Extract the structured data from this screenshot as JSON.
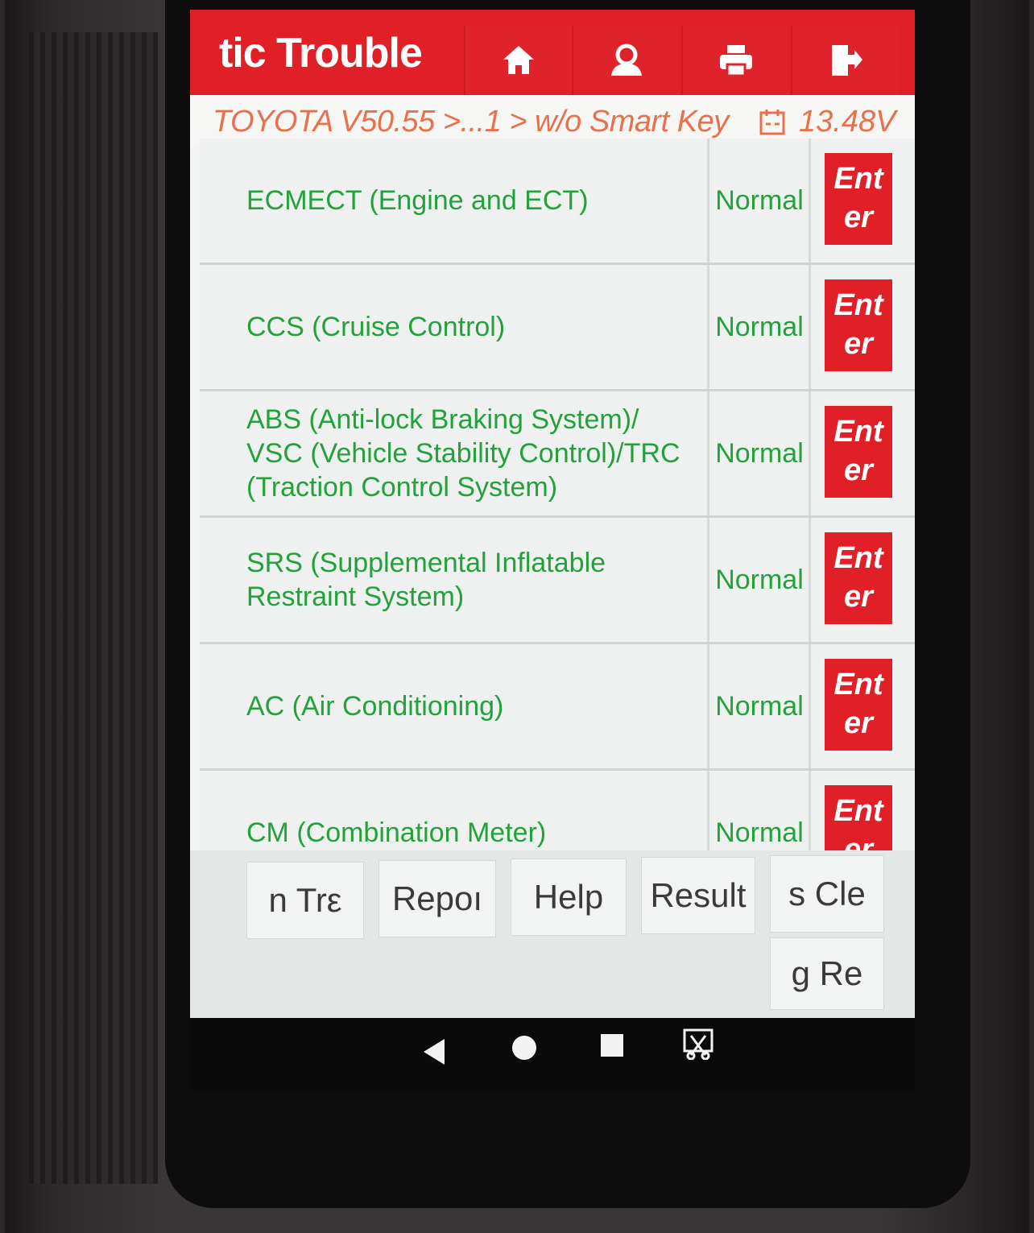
{
  "header": {
    "title": "tic Trouble",
    "buttons": [
      {
        "icon": "home-icon"
      },
      {
        "icon": "user-support-icon"
      },
      {
        "icon": "printer-icon"
      },
      {
        "icon": "exit-icon"
      }
    ]
  },
  "breadcrumb": {
    "path": "TOYOTA V50.55 >...1 > w/o Smart Key",
    "voltage": "13.48V",
    "icon": "calendar-battery-icon"
  },
  "systems": [
    {
      "name": "ECMECT (Engine and ECT)",
      "status": "Normal",
      "action": "Ent\ner"
    },
    {
      "name": "CCS (Cruise Control)",
      "status": "Normal",
      "action": "Ent\ner"
    },
    {
      "name": "ABS (Anti-lock Braking System)/\nVSC (Vehicle Stability Control)/TRC\n(Traction Control System)",
      "status": "Normal",
      "action": "Ent\ner"
    },
    {
      "name": "SRS (Supplemental Inflatable\nRestraint System)",
      "status": "Normal",
      "action": "Ent\ner"
    },
    {
      "name": "AC (Air Conditioning)",
      "status": "Normal",
      "action": "Ent\ner"
    },
    {
      "name": "CM (Combination Meter)",
      "status": "Normal",
      "action": "Ent\ner"
    }
  ],
  "bottom_buttons": [
    {
      "label": "n   Trε"
    },
    {
      "label": "Repoı"
    },
    {
      "label": "Help"
    },
    {
      "label": "Result"
    },
    {
      "label": "s   Cle"
    },
    {
      "label": "g   Re"
    }
  ],
  "android_nav": [
    "back-icon",
    "home-circle-icon",
    "recents-icon",
    "screenshot-icon"
  ],
  "colors": {
    "header_red": "#e01f26",
    "text_green": "#23a13a",
    "breadcrumb_orange": "#e8704a"
  }
}
